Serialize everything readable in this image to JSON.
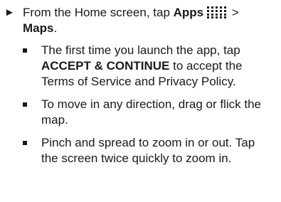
{
  "step": {
    "arrow": "►",
    "text_before": "From the Home screen, tap ",
    "apps_label": "Apps",
    "apps_icon": "apps-grid-icon",
    "separator": " > ",
    "maps_label": "Maps",
    "period": "."
  },
  "bullets": [
    {
      "pre": "The first time you launch the app, tap ",
      "bold": "ACCEPT & CONTINUE",
      "post": " to accept the Terms of Service and Privacy Policy."
    },
    {
      "pre": "To move in any direction, drag or flick the map.",
      "bold": "",
      "post": ""
    },
    {
      "pre": "Pinch and spread to zoom in or out. Tap the screen twice quickly to zoom in.",
      "bold": "",
      "post": ""
    }
  ]
}
